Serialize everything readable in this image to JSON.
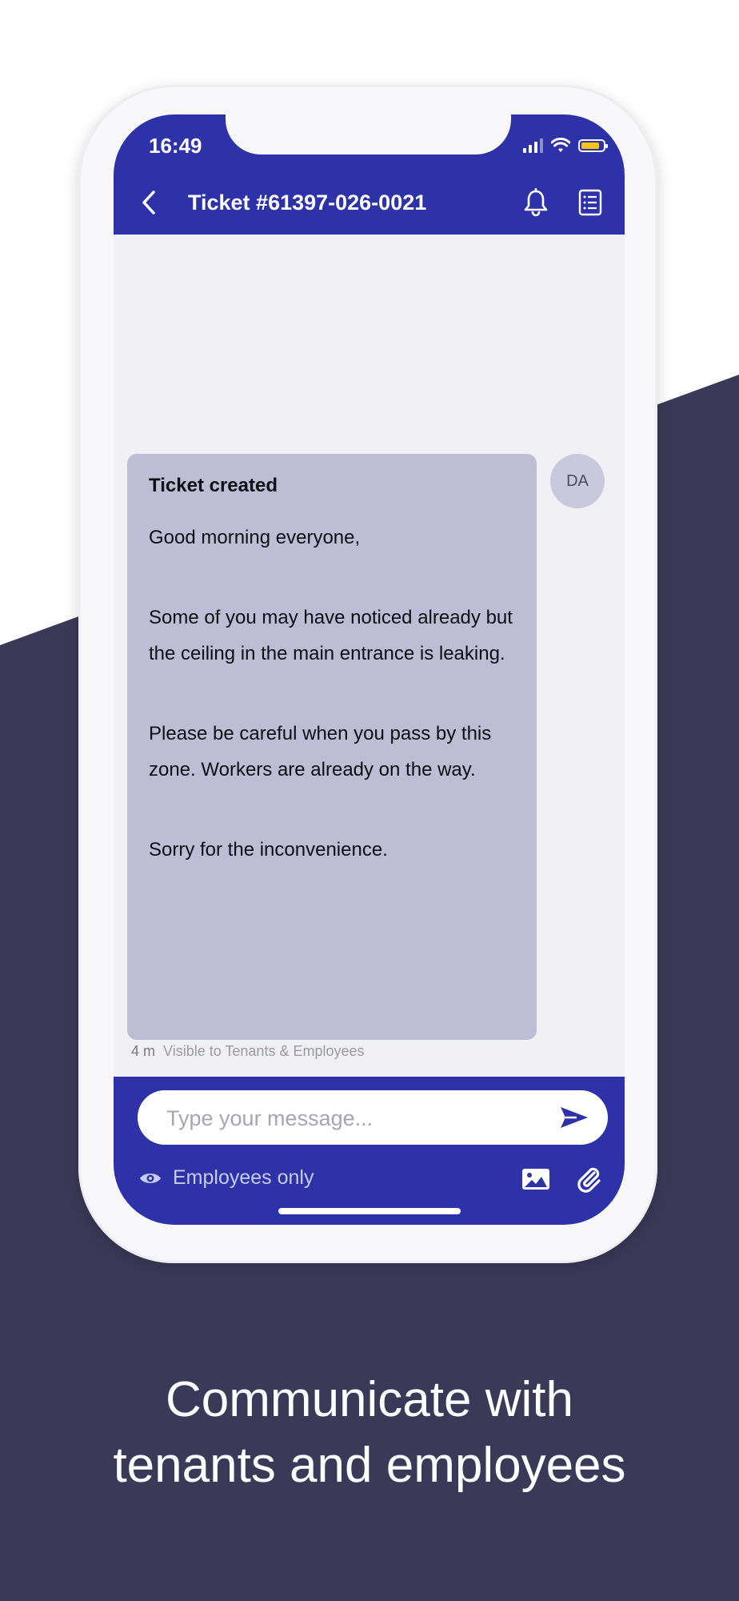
{
  "status_bar": {
    "time": "16:49"
  },
  "header": {
    "title": "Ticket #61397-026-0021",
    "back_icon": "chevron-left-icon",
    "notification_icon": "bell-icon",
    "details_icon": "list-icon"
  },
  "message": {
    "title": "Ticket created",
    "paragraphs": [
      "Good morning everyone,",
      "Some of you may have noticed already but the ceiling in the main entrance is leaking.",
      "Please be careful when you pass by this zone. Workers are already on the way.",
      "Sorry for the inconvenience."
    ],
    "avatar_initials": "DA",
    "age": "4 m",
    "visibility": "Visible to Tenants & Employees"
  },
  "composer": {
    "placeholder": "Type your message...",
    "visibility_label": "Employees only",
    "send_icon": "send-icon",
    "image_icon": "image-icon",
    "attach_icon": "paperclip-icon"
  },
  "caption": {
    "line1": "Communicate with",
    "line2": "tenants and employees"
  },
  "colors": {
    "brand": "#2e32a8",
    "background_dark": "#3a3a58",
    "bubble": "#bdbdd5",
    "battery": "#f5c518"
  }
}
